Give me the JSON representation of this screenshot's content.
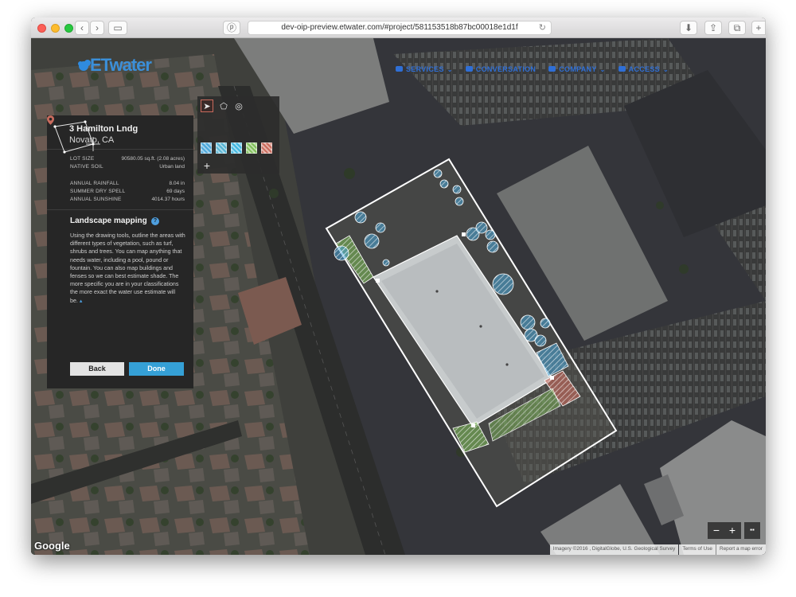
{
  "browser": {
    "url": "dev-oip-preview.etwater.com/#project/581153518b87bc00018e1d1f"
  },
  "brand": {
    "logo_text": "ETwater"
  },
  "nav": {
    "items": [
      {
        "label": "SERVICES",
        "has_caret": true
      },
      {
        "label": "CONVERSATION",
        "has_caret": false
      },
      {
        "label": "COMPANY",
        "has_caret": true
      },
      {
        "label": "ACCESS",
        "has_caret": true
      }
    ]
  },
  "toolbar": {
    "tools": [
      "select-pointer",
      "polygon",
      "circle"
    ],
    "add_label": "+",
    "swatch_colors": [
      "#4aa7da",
      "#54b3d3",
      "#3fb6e0",
      "#7fbf5a",
      "#c96b5d"
    ]
  },
  "property": {
    "street": "3 Hamilton Lndg",
    "city": "Novato, CA",
    "stats_group_1": [
      {
        "label": "LOT SIZE",
        "value": "90580.05 sq.ft. (2.08 acres)"
      },
      {
        "label": "NATIVE SOIL",
        "value": "Urban land"
      }
    ],
    "stats_group_2": [
      {
        "label": "ANNUAL RAINFALL",
        "value": "8.04 in"
      },
      {
        "label": "SUMMER DRY SPELL",
        "value": "69 days"
      },
      {
        "label": "ANNUAL SUNSHINE",
        "value": "4014.37 hours"
      }
    ]
  },
  "landscape_mapping": {
    "title": "Landscape mapping",
    "help_label": "?",
    "body": "Using the drawing tools, outline the areas with different types of vegetation, such as turf, shrubs and trees. You can map anything that needs water, including a pool, pound or fountain. You can also map buildings and fenses so we can best estimate shade. The more specific you are in your classifications the more exact the water use estimate will be.",
    "collapse_glyph": "▴",
    "back_label": "Back",
    "done_label": "Done"
  },
  "map": {
    "google_label": "Google",
    "attribution": [
      "Imagery ©2016 , DigitalGlobe, U.S. Geological Survey",
      "Terms of Use",
      "Report a map error"
    ],
    "zoom_out_label": "−",
    "zoom_in_label": "+",
    "layers_label": "▪▪"
  },
  "colors": {
    "accent_blue": "#35a0d6",
    "nav_blue": "#2f6fd6",
    "tree_blue": "#4aa7da",
    "turf_green": "#7fbf5a",
    "hardscape_red": "#c96b5d"
  }
}
